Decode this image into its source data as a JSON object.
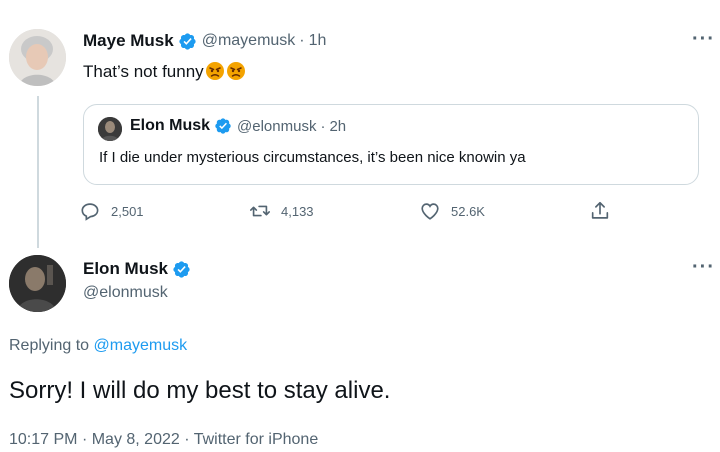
{
  "parent_tweet": {
    "display_name": "Maye Musk",
    "handle": "@mayemusk",
    "separator": "·",
    "time": "1h",
    "text": "That’s not funny",
    "emojis": [
      "angry-face-emoji",
      "angry-face-emoji"
    ],
    "quote": {
      "display_name": "Elon Musk",
      "handle": "@elonmusk",
      "separator": "·",
      "time": "2h",
      "text": "If I die under mysterious circumstances, it’s been nice knowin ya"
    },
    "actions": {
      "replies": "2,501",
      "retweets": "4,133",
      "likes": "52.6K"
    }
  },
  "reply_tweet": {
    "display_name": "Elon Musk",
    "handle": "@elonmusk",
    "replying_prefix": "Replying to",
    "replying_to": "@mayemusk",
    "text": "Sorry! I will do my best to stay alive.",
    "time": "10:17 PM",
    "date": "May 8, 2022",
    "source": "Twitter for iPhone",
    "meta_separator": "·"
  },
  "more_label": "···",
  "colors": {
    "verified_blue": "#1d9bf0",
    "secondary_text": "#536471",
    "primary_text": "#0f1419",
    "border": "#cfd9de"
  },
  "icons": [
    "verified-badge-icon",
    "more-options-icon",
    "reply-icon",
    "retweet-icon",
    "like-icon",
    "share-icon"
  ]
}
